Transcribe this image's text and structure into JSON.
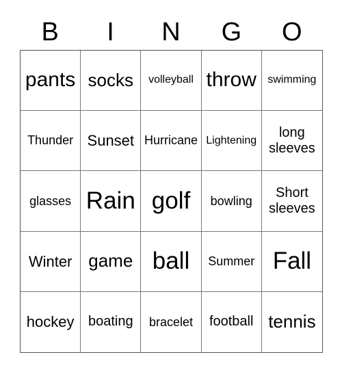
{
  "header": {
    "letters": [
      "B",
      "I",
      "N",
      "G",
      "O"
    ]
  },
  "cells": [
    [
      "pants",
      "socks",
      "volleyball",
      "throw",
      "swimming"
    ],
    [
      "Thunder",
      "Sunset",
      "Hurricane",
      "Lightening",
      "long sleeves"
    ],
    [
      "glasses",
      "Rain",
      "golf",
      "bowling",
      "Short sleeves"
    ],
    [
      "Winter",
      "game",
      "ball",
      "Summer",
      "Fall"
    ],
    [
      "hockey",
      "boating",
      "bracelet",
      "football",
      "tennis"
    ]
  ]
}
